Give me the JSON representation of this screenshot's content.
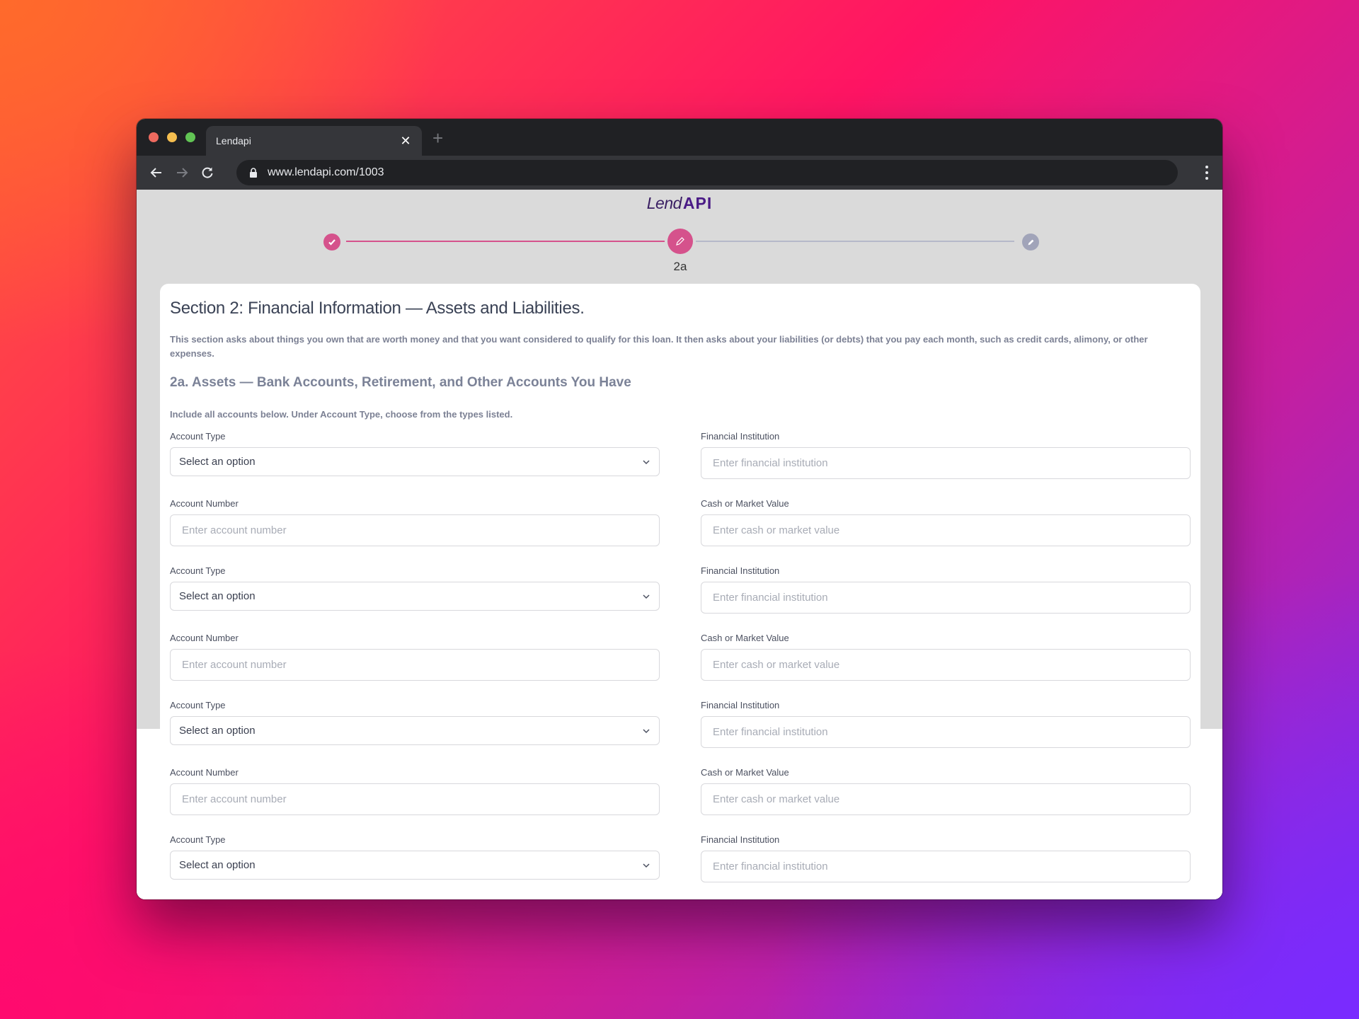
{
  "browser": {
    "tab_title": "Lendapi",
    "url": "www.lendapi.com/1003",
    "new_tab_symbol": "+",
    "close_symbol": "✕"
  },
  "logo": {
    "part1": "Lend",
    "part2": "API"
  },
  "stepper": {
    "steps": [
      {
        "state": "completed",
        "icon": "check-icon"
      },
      {
        "state": "active",
        "icon": "pencil-icon",
        "label": "2a"
      },
      {
        "state": "pending",
        "icon": "pencil-icon"
      }
    ],
    "current_label": "2a",
    "colors": {
      "active": "#d5528c",
      "pending": "#a1a4b9"
    }
  },
  "form": {
    "section_title": "Section 2: Financial Information — Assets and Liabilities.",
    "intro": "This section asks about things you own that are worth money and that you want considered to qualify for this loan. It then asks about your liabilities (or debts) that you pay each month, such as credit cards, alimony, or other expenses.",
    "subsection_title": "2a. Assets — Bank Accounts, Retirement, and Other Accounts You Have",
    "instructions": "Include all accounts below. Under Account Type, choose from the types listed.",
    "labels": {
      "account_type": "Account Type",
      "financial_institution": "Financial Institution",
      "account_number": "Account Number",
      "cash_value": "Cash or Market Value"
    },
    "placeholders": {
      "financial_institution": "Enter financial institution",
      "account_number": "Enter account number",
      "cash_value": "Enter cash or market value"
    },
    "select_default": "Select an option",
    "accounts": [
      {
        "account_type": "Select an option",
        "financial_institution": "",
        "account_number": "",
        "cash_value": ""
      },
      {
        "account_type": "Select an option",
        "financial_institution": "",
        "account_number": "",
        "cash_value": ""
      },
      {
        "account_type": "Select an option",
        "financial_institution": "",
        "account_number": "",
        "cash_value": ""
      },
      {
        "account_type": "Select an option",
        "financial_institution": ""
      }
    ]
  }
}
